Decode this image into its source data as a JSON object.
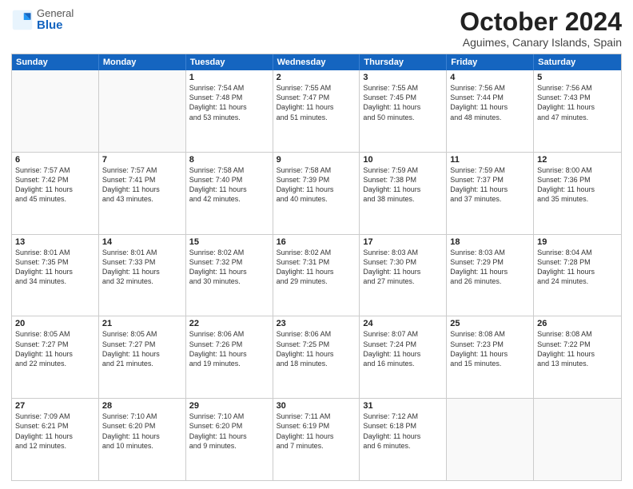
{
  "logo": {
    "general": "General",
    "blue": "Blue"
  },
  "header": {
    "month": "October 2024",
    "location": "Aguimes, Canary Islands, Spain"
  },
  "day_headers": [
    "Sunday",
    "Monday",
    "Tuesday",
    "Wednesday",
    "Thursday",
    "Friday",
    "Saturday"
  ],
  "weeks": [
    [
      {
        "num": "",
        "info": "",
        "empty": true
      },
      {
        "num": "",
        "info": "",
        "empty": true
      },
      {
        "num": "1",
        "info": "Sunrise: 7:54 AM\nSunset: 7:48 PM\nDaylight: 11 hours\nand 53 minutes."
      },
      {
        "num": "2",
        "info": "Sunrise: 7:55 AM\nSunset: 7:47 PM\nDaylight: 11 hours\nand 51 minutes."
      },
      {
        "num": "3",
        "info": "Sunrise: 7:55 AM\nSunset: 7:45 PM\nDaylight: 11 hours\nand 50 minutes."
      },
      {
        "num": "4",
        "info": "Sunrise: 7:56 AM\nSunset: 7:44 PM\nDaylight: 11 hours\nand 48 minutes."
      },
      {
        "num": "5",
        "info": "Sunrise: 7:56 AM\nSunset: 7:43 PM\nDaylight: 11 hours\nand 47 minutes."
      }
    ],
    [
      {
        "num": "6",
        "info": "Sunrise: 7:57 AM\nSunset: 7:42 PM\nDaylight: 11 hours\nand 45 minutes."
      },
      {
        "num": "7",
        "info": "Sunrise: 7:57 AM\nSunset: 7:41 PM\nDaylight: 11 hours\nand 43 minutes."
      },
      {
        "num": "8",
        "info": "Sunrise: 7:58 AM\nSunset: 7:40 PM\nDaylight: 11 hours\nand 42 minutes."
      },
      {
        "num": "9",
        "info": "Sunrise: 7:58 AM\nSunset: 7:39 PM\nDaylight: 11 hours\nand 40 minutes."
      },
      {
        "num": "10",
        "info": "Sunrise: 7:59 AM\nSunset: 7:38 PM\nDaylight: 11 hours\nand 38 minutes."
      },
      {
        "num": "11",
        "info": "Sunrise: 7:59 AM\nSunset: 7:37 PM\nDaylight: 11 hours\nand 37 minutes."
      },
      {
        "num": "12",
        "info": "Sunrise: 8:00 AM\nSunset: 7:36 PM\nDaylight: 11 hours\nand 35 minutes."
      }
    ],
    [
      {
        "num": "13",
        "info": "Sunrise: 8:01 AM\nSunset: 7:35 PM\nDaylight: 11 hours\nand 34 minutes."
      },
      {
        "num": "14",
        "info": "Sunrise: 8:01 AM\nSunset: 7:33 PM\nDaylight: 11 hours\nand 32 minutes."
      },
      {
        "num": "15",
        "info": "Sunrise: 8:02 AM\nSunset: 7:32 PM\nDaylight: 11 hours\nand 30 minutes."
      },
      {
        "num": "16",
        "info": "Sunrise: 8:02 AM\nSunset: 7:31 PM\nDaylight: 11 hours\nand 29 minutes."
      },
      {
        "num": "17",
        "info": "Sunrise: 8:03 AM\nSunset: 7:30 PM\nDaylight: 11 hours\nand 27 minutes."
      },
      {
        "num": "18",
        "info": "Sunrise: 8:03 AM\nSunset: 7:29 PM\nDaylight: 11 hours\nand 26 minutes."
      },
      {
        "num": "19",
        "info": "Sunrise: 8:04 AM\nSunset: 7:28 PM\nDaylight: 11 hours\nand 24 minutes."
      }
    ],
    [
      {
        "num": "20",
        "info": "Sunrise: 8:05 AM\nSunset: 7:27 PM\nDaylight: 11 hours\nand 22 minutes."
      },
      {
        "num": "21",
        "info": "Sunrise: 8:05 AM\nSunset: 7:27 PM\nDaylight: 11 hours\nand 21 minutes."
      },
      {
        "num": "22",
        "info": "Sunrise: 8:06 AM\nSunset: 7:26 PM\nDaylight: 11 hours\nand 19 minutes."
      },
      {
        "num": "23",
        "info": "Sunrise: 8:06 AM\nSunset: 7:25 PM\nDaylight: 11 hours\nand 18 minutes."
      },
      {
        "num": "24",
        "info": "Sunrise: 8:07 AM\nSunset: 7:24 PM\nDaylight: 11 hours\nand 16 minutes."
      },
      {
        "num": "25",
        "info": "Sunrise: 8:08 AM\nSunset: 7:23 PM\nDaylight: 11 hours\nand 15 minutes."
      },
      {
        "num": "26",
        "info": "Sunrise: 8:08 AM\nSunset: 7:22 PM\nDaylight: 11 hours\nand 13 minutes."
      }
    ],
    [
      {
        "num": "27",
        "info": "Sunrise: 7:09 AM\nSunset: 6:21 PM\nDaylight: 11 hours\nand 12 minutes."
      },
      {
        "num": "28",
        "info": "Sunrise: 7:10 AM\nSunset: 6:20 PM\nDaylight: 11 hours\nand 10 minutes."
      },
      {
        "num": "29",
        "info": "Sunrise: 7:10 AM\nSunset: 6:20 PM\nDaylight: 11 hours\nand 9 minutes."
      },
      {
        "num": "30",
        "info": "Sunrise: 7:11 AM\nSunset: 6:19 PM\nDaylight: 11 hours\nand 7 minutes."
      },
      {
        "num": "31",
        "info": "Sunrise: 7:12 AM\nSunset: 6:18 PM\nDaylight: 11 hours\nand 6 minutes."
      },
      {
        "num": "",
        "info": "",
        "empty": true
      },
      {
        "num": "",
        "info": "",
        "empty": true
      }
    ]
  ]
}
